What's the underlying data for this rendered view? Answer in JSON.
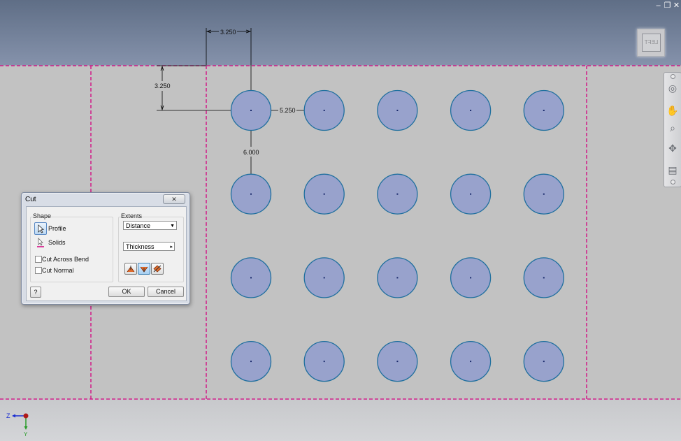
{
  "window_controls": {
    "minimize": "–",
    "restore": "❐",
    "close": "✕"
  },
  "viewcube": {
    "face_label": "LEFT"
  },
  "navbar": {
    "tools": [
      "steering-wheel-icon",
      "pan-icon",
      "zoom-icon",
      "orbit-icon",
      "look-at-icon"
    ]
  },
  "sketch": {
    "dimensions": {
      "horizontal_offset": "3.250",
      "vertical_offset": "3.250",
      "column_spacing": "5.250",
      "row_spacing": "6.000"
    },
    "pattern": {
      "columns": 5,
      "rows": 4
    },
    "colors": {
      "hole_fill": "#98a2cc",
      "hole_stroke": "#1f6f9e",
      "bend_line": "#d4007f",
      "dimension": "#000000"
    }
  },
  "triad": {
    "z_label": "Z",
    "y_label": "Y"
  },
  "cut_dialog": {
    "title": "Cut",
    "close_label": "✕",
    "shape": {
      "group_title": "Shape",
      "profile_label": "Profile",
      "solids_label": "Solids",
      "cut_across_bend_label": "Cut Across Bend",
      "cut_normal_label": "Cut Normal"
    },
    "extents": {
      "group_title": "Extents",
      "extent_type": "Distance",
      "distance_value": "Thickness",
      "arrow": "▸"
    },
    "help_label": "?",
    "ok_label": "OK",
    "cancel_label": "Cancel"
  }
}
